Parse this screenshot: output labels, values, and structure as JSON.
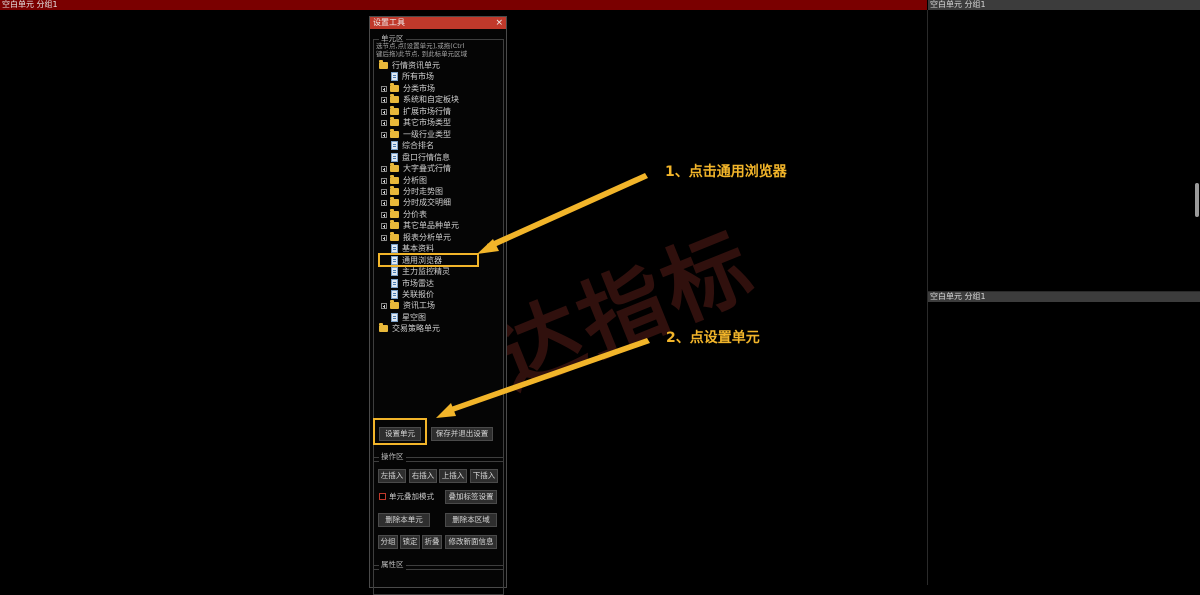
{
  "panes": {
    "main_header": "空白单元 分组1",
    "right_top_header": "空白单元 分组1",
    "right_bottom_header": "空白单元 分组1"
  },
  "dialog": {
    "title": "设置工具",
    "close_glyph": "×",
    "unit_group_label": "单元区",
    "hint_line1": "选节点,点[设置单元],或拖(Ctrl",
    "hint_line2": "键后拖)此节点, 到此标单元区域",
    "tree": [
      {
        "label": "行情资讯单元",
        "icon": "folder-icon",
        "expander": false,
        "level": 0
      },
      {
        "label": "所有市场",
        "icon": "document-icon",
        "expander": false,
        "level": 1
      },
      {
        "label": "分类市场",
        "icon": "folder-icon",
        "expander": true,
        "level": 1
      },
      {
        "label": "系统和自定板块",
        "icon": "folder-icon",
        "expander": true,
        "level": 1
      },
      {
        "label": "扩展市场行情",
        "icon": "folder-icon",
        "expander": true,
        "level": 1
      },
      {
        "label": "其它市场类型",
        "icon": "folder-icon",
        "expander": true,
        "level": 1
      },
      {
        "label": "一级行业类型",
        "icon": "folder-icon",
        "expander": true,
        "level": 1
      },
      {
        "label": "综合排名",
        "icon": "document-icon",
        "expander": false,
        "level": 1
      },
      {
        "label": "盘口行情信息",
        "icon": "document-icon",
        "expander": false,
        "level": 1
      },
      {
        "label": "大字叠式行情",
        "icon": "folder-icon",
        "expander": true,
        "level": 1
      },
      {
        "label": "分析图",
        "icon": "folder-icon",
        "expander": true,
        "level": 1
      },
      {
        "label": "分时走势图",
        "icon": "folder-icon",
        "expander": true,
        "level": 1
      },
      {
        "label": "分时成交明细",
        "icon": "folder-icon",
        "expander": true,
        "level": 1
      },
      {
        "label": "分价表",
        "icon": "folder-icon",
        "expander": true,
        "level": 1
      },
      {
        "label": "其它单品种单元",
        "icon": "folder-icon",
        "expander": true,
        "level": 1
      },
      {
        "label": "报表分析单元",
        "icon": "folder-icon",
        "expander": true,
        "level": 1
      },
      {
        "label": "基本资料",
        "icon": "document-icon",
        "expander": false,
        "level": 1
      },
      {
        "label": "通用浏览器",
        "icon": "document-icon",
        "expander": false,
        "level": 1
      },
      {
        "label": "主力监控精灵",
        "icon": "document-icon",
        "expander": false,
        "level": 1
      },
      {
        "label": "市场雷达",
        "icon": "document-icon",
        "expander": false,
        "level": 1
      },
      {
        "label": "关联报价",
        "icon": "document-icon",
        "expander": false,
        "level": 1
      },
      {
        "label": "资讯工场",
        "icon": "folder-icon",
        "expander": true,
        "level": 1
      },
      {
        "label": "星空图",
        "icon": "document-icon",
        "expander": false,
        "level": 1
      },
      {
        "label": "交易策略单元",
        "icon": "folder-icon",
        "expander": false,
        "level": 0
      }
    ],
    "btn_set_unit": "设置单元",
    "btn_save_exit": "保存并退出设置",
    "ops_group_label": "操作区",
    "btn_insert_left": "左插入",
    "btn_insert_right": "右插入",
    "btn_insert_up": "上插入",
    "btn_insert_down": "下插入",
    "overlay_mode_label": "单元叠加模式",
    "btn_overlay_tab": "叠加标签设置",
    "btn_delete_unit": "删除本单元",
    "btn_delete_area": "删除本区域",
    "btn_group": "分组",
    "btn_lock": "锁定",
    "btn_fold": "折叠",
    "btn_edit_page": "修改新面信息",
    "props_group_label": "属性区"
  },
  "annotations": {
    "step1": "1、点击通用浏览器",
    "step2": "2、点设置单元",
    "watermark": "铭达指标"
  },
  "colors": {
    "highlight": "#f2b52a",
    "title_bar": "#c0392b",
    "main_header": "#7a0000"
  }
}
